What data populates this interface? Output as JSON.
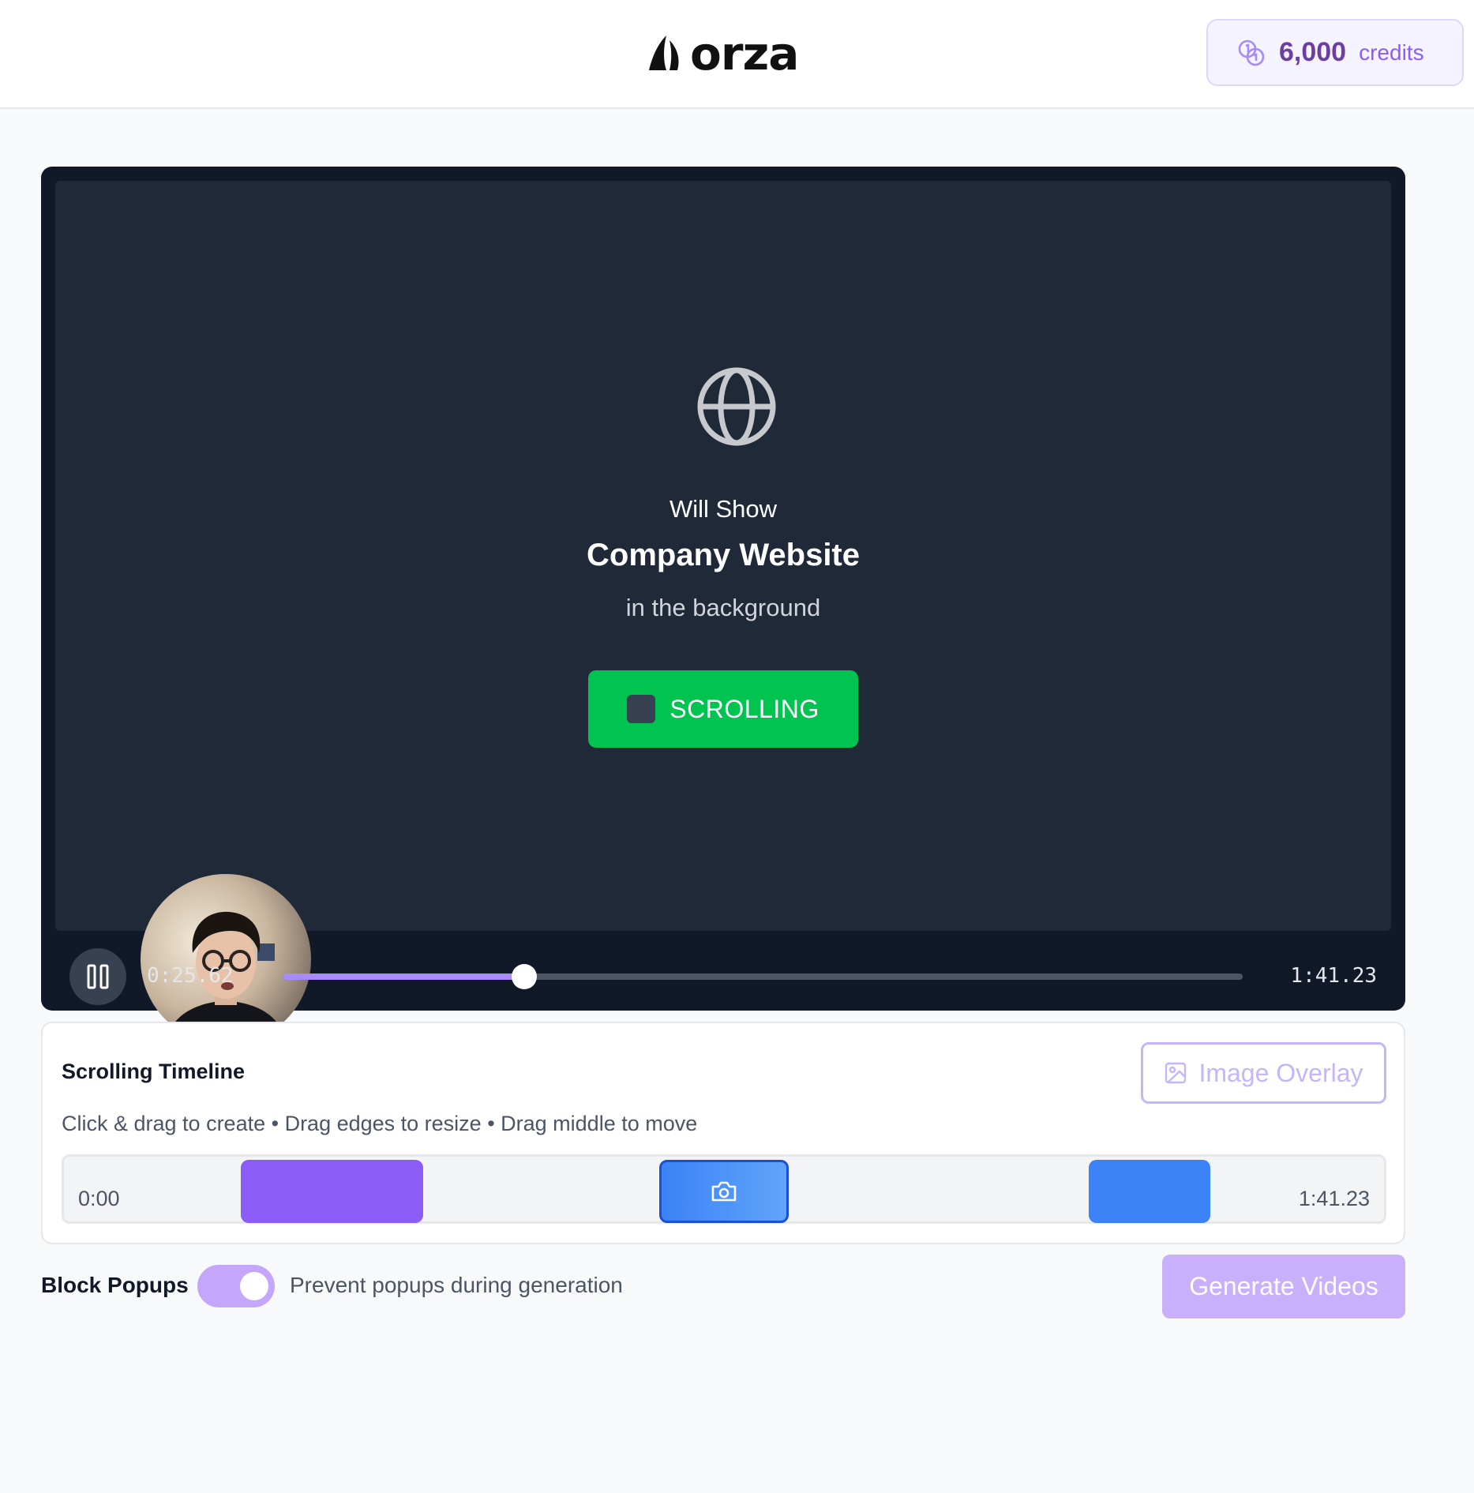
{
  "header": {
    "logo_text": "orza",
    "credits_amount": "6,000",
    "credits_label": "credits"
  },
  "player": {
    "preview": {
      "line1": "Will Show",
      "title": "Company Website",
      "line3": "in the background",
      "button_label": "SCROLLING"
    },
    "time_current": "0:25.62",
    "time_total": "1:41.23",
    "progress_fraction": 0.252
  },
  "timeline": {
    "title": "Scrolling Timeline",
    "overlay_button": "Image Overlay",
    "hint": "Click & drag to create • Drag edges to resize • Drag middle to move",
    "start_label": "0:00",
    "end_label": "1:41.23"
  },
  "options": {
    "block_popups_label": "Block Popups",
    "block_popups_enabled": true,
    "block_popups_desc": "Prevent popups during generation",
    "generate_button": "Generate Videos"
  },
  "colors": {
    "accent": "#8b5cf6",
    "scrolling_green": "#00c44f",
    "segment_blue": "#3b82f6"
  }
}
